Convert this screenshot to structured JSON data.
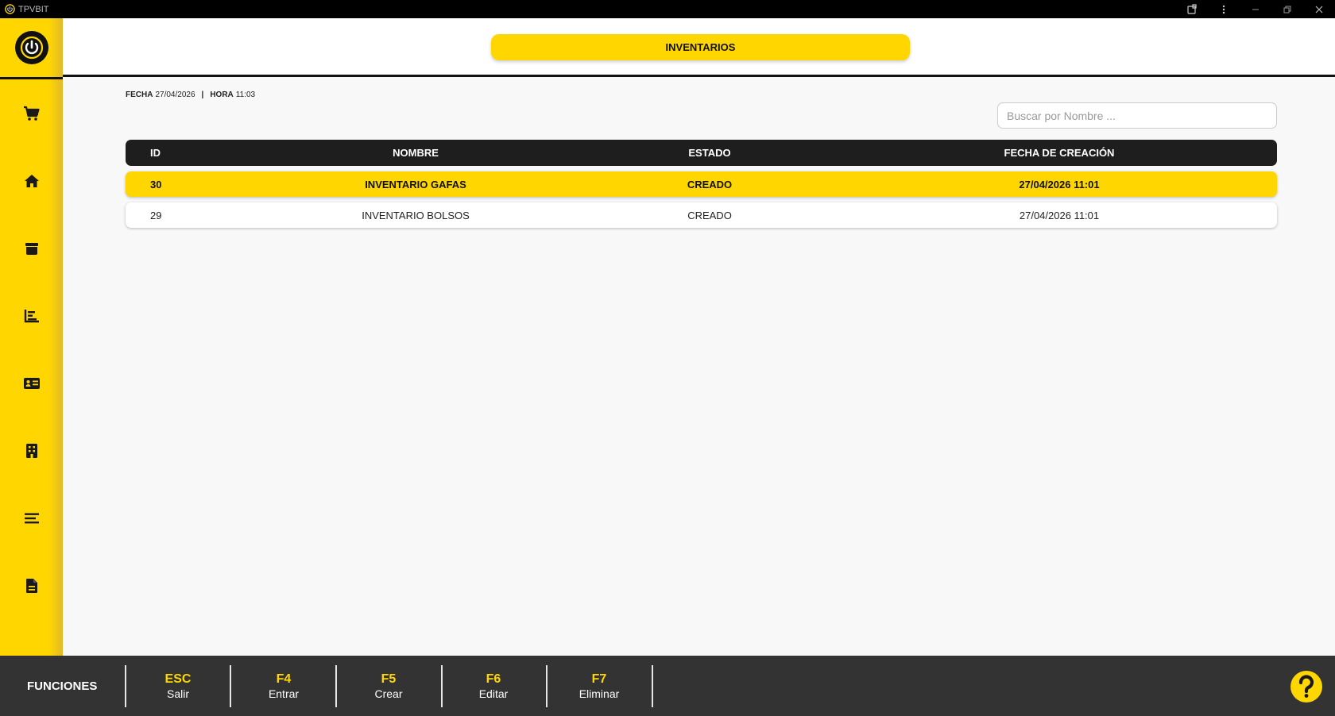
{
  "window": {
    "title": "TPVBIT"
  },
  "header": {
    "title": "INVENTARIOS"
  },
  "info": {
    "fecha_label": "FECHA",
    "fecha_value": "27/04/2026",
    "separator": "|",
    "hora_label": "HORA",
    "hora_value": "11:03"
  },
  "search": {
    "placeholder": "Buscar por Nombre ...",
    "value": ""
  },
  "table": {
    "columns": [
      "ID",
      "NOMBRE",
      "ESTADO",
      "FECHA DE CREACIÓN"
    ],
    "rows": [
      {
        "id": "30",
        "nombre": "INVENTARIO GAFAS",
        "estado": "CREADO",
        "fecha": "27/04/2026 11:01",
        "selected": true
      },
      {
        "id": "29",
        "nombre": "INVENTARIO BOLSOS",
        "estado": "CREADO",
        "fecha": "27/04/2026 11:01",
        "selected": false
      }
    ]
  },
  "sidebar": {
    "items": [
      {
        "icon": "cart-icon"
      },
      {
        "icon": "home-icon"
      },
      {
        "icon": "box-icon"
      },
      {
        "icon": "chart-icon"
      },
      {
        "icon": "id-card-icon"
      },
      {
        "icon": "building-icon"
      },
      {
        "icon": "list-icon"
      },
      {
        "icon": "document-icon"
      }
    ]
  },
  "footer": {
    "label": "FUNCIONES",
    "keys": [
      {
        "key": "ESC",
        "label": "Salir"
      },
      {
        "key": "F4",
        "label": "Entrar"
      },
      {
        "key": "F5",
        "label": "Crear"
      },
      {
        "key": "F6",
        "label": "Editar"
      },
      {
        "key": "F7",
        "label": "Eliminar"
      }
    ]
  },
  "colors": {
    "accent": "#ffd600",
    "dark": "#1e1e1e",
    "footer": "#333333",
    "background": "#f8f8f8"
  }
}
